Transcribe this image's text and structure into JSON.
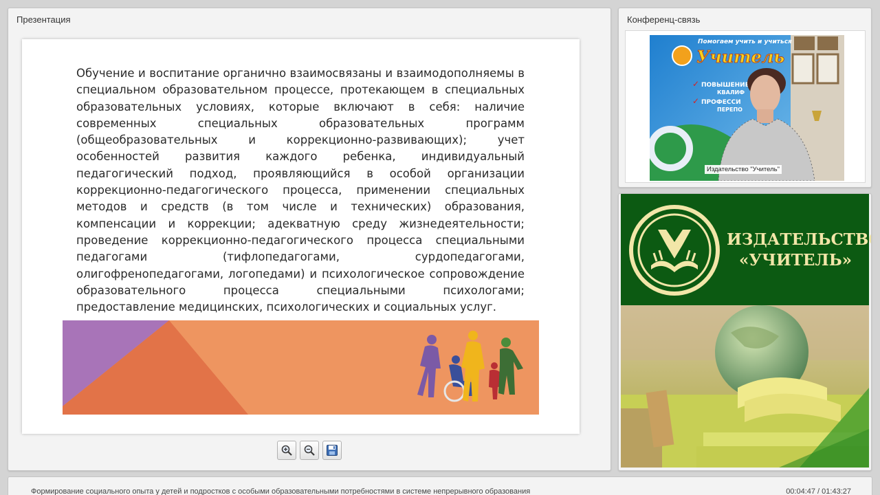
{
  "presentation": {
    "title": "Презентация",
    "slide": {
      "text": "Обучение и воспитание органично взаимосвязаны и взаимодополняемы в специальном образовательном процессе, протекающем в специальных образовательных условиях, которые включают в себя: наличие современных специальных образовательных программ (общеобразовательных и коррекционно-развивающих); учет особенностей развития каждого ребенка, индивидуальный педагогический подход, проявляющийся в особой организации коррекционно-педагогического процесса, применении специальных методов и средств (в том числе и технических) образования, компенсации и коррекции; адекватную среду жизнедеятельности; проведение коррекционно-педагогического процесса специальными педагогами (тифлопедагогами, сурдопедагогами, олигофренопедагогами, логопедами) и психологическое сопровождение образовательного процесса специальными психологами; предоставление медицинских, психологических и социальных услуг."
    },
    "toolbar": {
      "zoom_in_icon": "zoom-in-icon",
      "zoom_out_icon": "zoom-out-icon",
      "save_icon": "floppy-disk-icon"
    }
  },
  "conference": {
    "title": "Конференц-связь",
    "video_caption": "Издательство \"Учитель\"",
    "banner": {
      "top_line": "Помогаем учить и учиться",
      "brand": "Учитель",
      "item_1": "ПОВЫШЕНИЕ",
      "item_1b": "КВАЛИФ",
      "item_2": "ПРОФЕССИ",
      "item_2b": "ПЕРЕПО"
    }
  },
  "publisher": {
    "name_line1": "ИЗДАТЕЛЬСТВО",
    "name_line2": "«УЧИТЕЛЬ»"
  },
  "footer": {
    "course_title": "Формирование социального опыта у детей и подростков с особыми образовательными потребностями в системе непрерывного образования",
    "time": "00:04:47 / 01:43:27"
  },
  "colors": {
    "banner_purple": "#a874b8",
    "banner_orange": "#ee9560",
    "banner_dark_orange": "#e27348",
    "publisher_green": "#0c5a12",
    "publisher_gold": "#f2e6a8"
  }
}
